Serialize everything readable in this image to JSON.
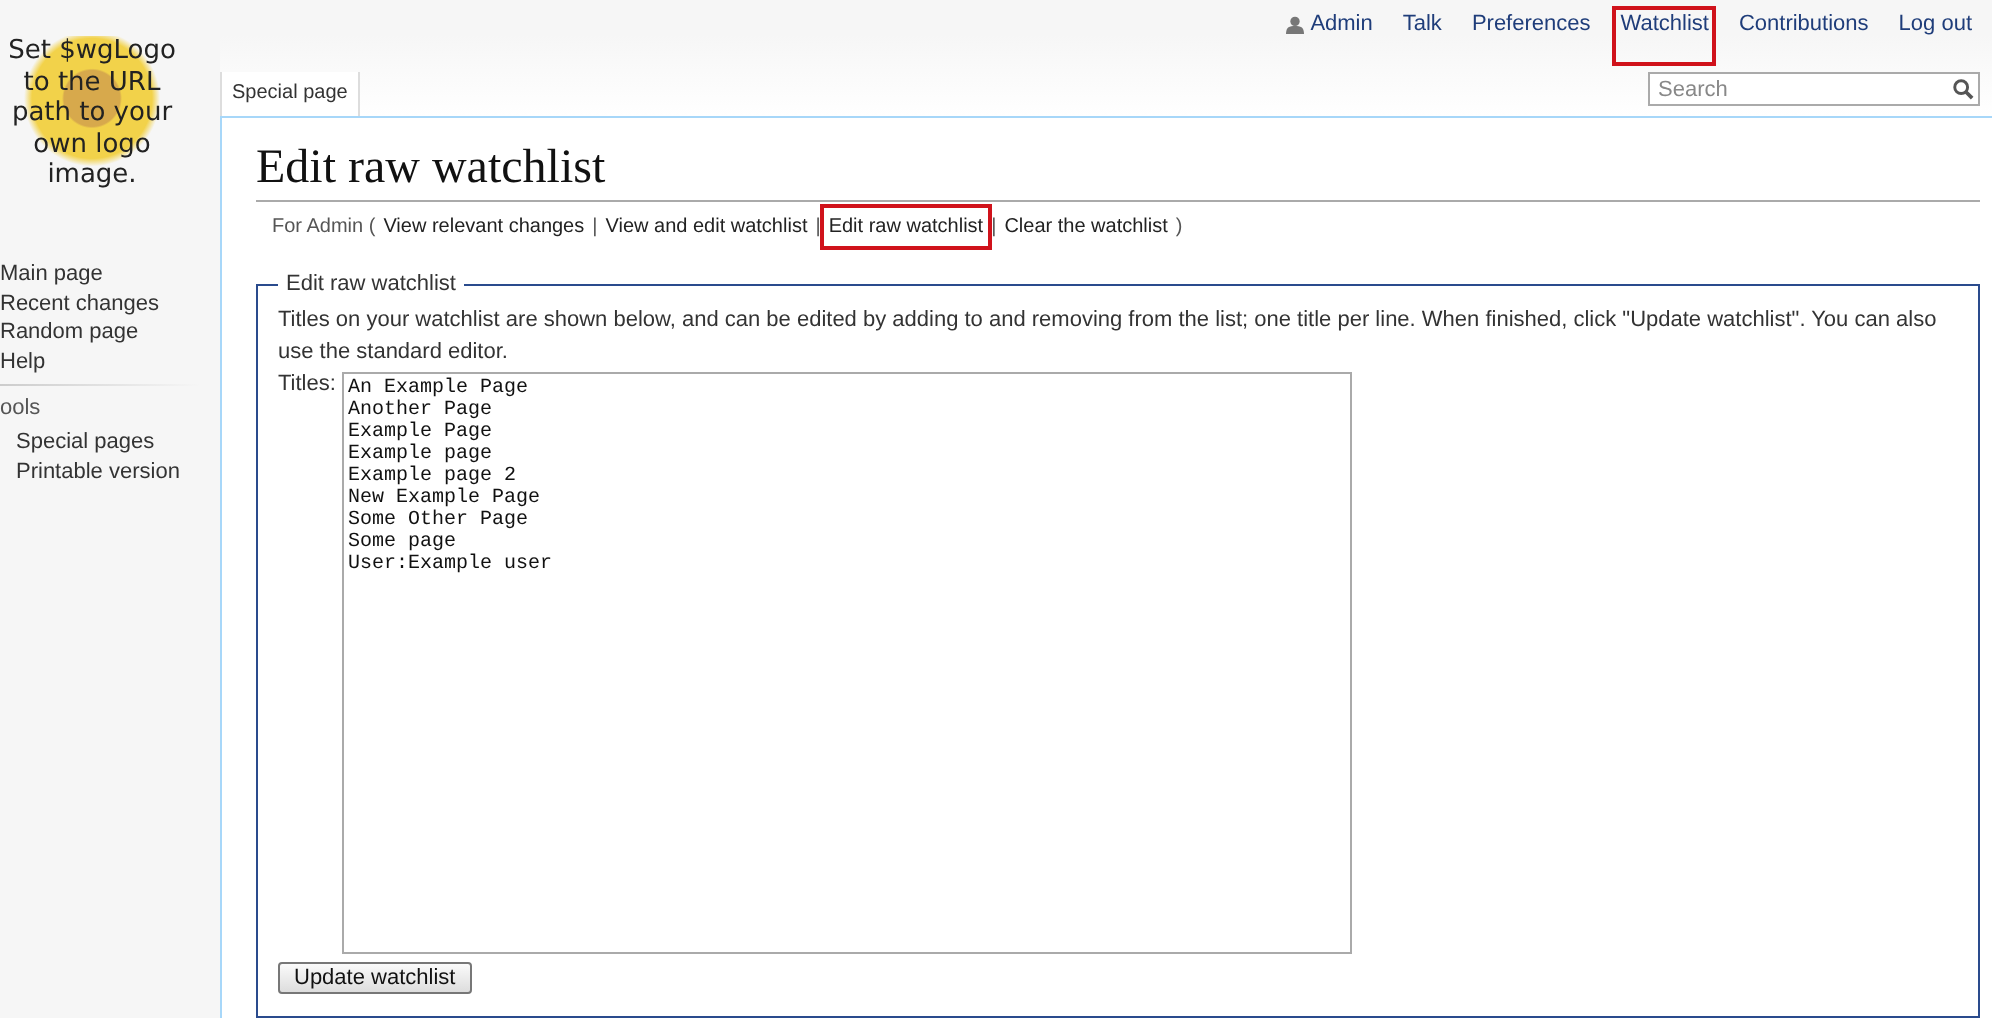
{
  "logo": {
    "text": "Set $wgLogo to the URL path to your own logo image."
  },
  "personal_links": [
    {
      "label": "Admin",
      "kind": "user",
      "highlighted": false
    },
    {
      "label": "Talk",
      "kind": "link",
      "highlighted": false
    },
    {
      "label": "Preferences",
      "kind": "link",
      "highlighted": false
    },
    {
      "label": "Watchlist",
      "kind": "link",
      "highlighted": true
    },
    {
      "label": "Contributions",
      "kind": "link",
      "highlighted": false
    },
    {
      "label": "Log out",
      "kind": "link",
      "highlighted": false
    }
  ],
  "tabs": [
    {
      "label": "Special page",
      "selected": true
    }
  ],
  "search": {
    "placeholder": "Search"
  },
  "sidebar": {
    "navigation": [
      "Main page",
      "Recent changes",
      "Random page",
      "Help"
    ],
    "tools": {
      "heading": "ools",
      "items": [
        "Special pages",
        "Printable version"
      ]
    }
  },
  "page": {
    "title": "Edit raw watchlist",
    "subtitle": {
      "prefix": "For Admin (",
      "links": [
        {
          "label": "View relevant changes",
          "highlighted": false
        },
        {
          "label": "View and edit watchlist",
          "highlighted": false
        },
        {
          "label": "Edit raw watchlist",
          "highlighted": true
        },
        {
          "label": "Clear the watchlist",
          "highlighted": false
        }
      ],
      "separator": "|",
      "suffix": ")"
    },
    "form": {
      "legend": "Edit raw watchlist",
      "intro": "Titles on your watchlist are shown below, and can be edited by adding to and removing from the list; one title per line. When finished, click \"Update watchlist\". You can also use the standard editor.",
      "field_label": "Titles:",
      "titles": [
        "An Example Page",
        "Another Page",
        "Example Page",
        "Example page",
        "Example page 2",
        "New Example Page",
        "Some Other Page",
        "Some page",
        "User:Example user"
      ],
      "button": "Update watchlist"
    }
  }
}
